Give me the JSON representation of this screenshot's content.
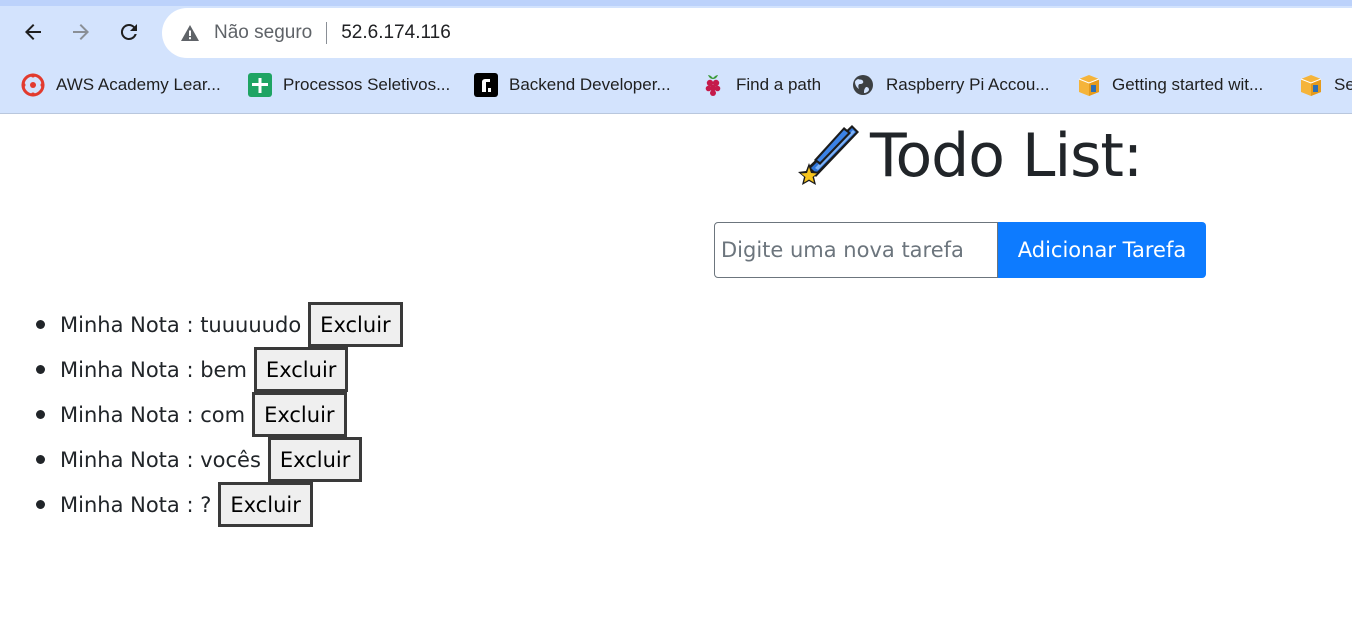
{
  "browser": {
    "security_label": "Não seguro",
    "url": "52.6.174.116",
    "bookmarks": [
      {
        "label": "AWS Academy Lear...",
        "icon": "canvas-icon"
      },
      {
        "label": "Processos Seletivos...",
        "icon": "green-sheet-icon"
      },
      {
        "label": "Backend Developer...",
        "icon": "roadmap-icon"
      },
      {
        "label": "Find a path",
        "icon": "raspberry-icon"
      },
      {
        "label": "Raspberry Pi Accou...",
        "icon": "globe-icon"
      },
      {
        "label": "Getting started wit...",
        "icon": "box-icon"
      },
      {
        "label": "Se",
        "icon": "box-icon"
      }
    ]
  },
  "app": {
    "title": "Todo List:",
    "input_placeholder": "Digite uma nova tarefa",
    "input_value": "",
    "add_button": "Adicionar Tarefa",
    "delete_label": "Excluir",
    "todos": [
      {
        "text": "Minha Nota : tuuuuudo"
      },
      {
        "text": "Minha Nota : bem"
      },
      {
        "text": "Minha Nota : com"
      },
      {
        "text": "Minha Nota : vocês"
      },
      {
        "text": "Minha Nota : ?"
      }
    ]
  },
  "colors": {
    "chrome_bg": "#d3e3fd",
    "primary": "#0d7bff",
    "text": "#212529"
  }
}
